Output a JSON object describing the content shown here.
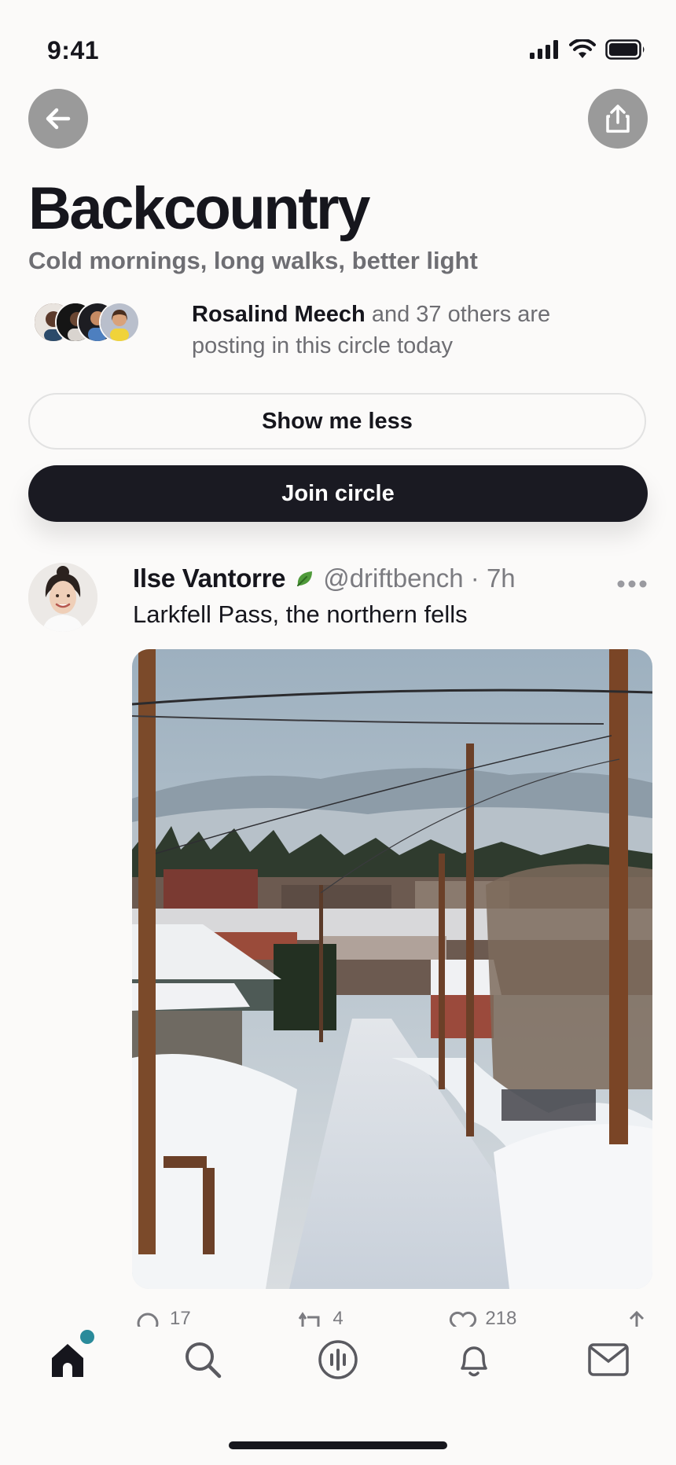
{
  "status_bar": {
    "time": "9:41"
  },
  "header": {
    "back_icon": "arrow-left-icon",
    "share_icon": "share-icon",
    "title": "Backcountry",
    "subtitle": "Cold mornings, long walks, better light"
  },
  "activity": {
    "name": "Rosalind Meech",
    "text": "and 37 others are posting in this circle today"
  },
  "buttons": {
    "show_less": "Show me less",
    "join": "Join circle"
  },
  "post": {
    "author": "Ilse Vantorre",
    "badge_icon": "leaf-icon",
    "handle": "@driftbench · 7h",
    "text": "Larkfell Pass, the northern fells",
    "image_desc_icon": "photo",
    "actions": {
      "replies": "17",
      "reposts": "4",
      "likes": "218"
    }
  },
  "tabbar": {
    "items": [
      "home-icon",
      "search-icon",
      "spaces-icon",
      "bell-icon",
      "mail-icon"
    ],
    "accent": "#2a8a9a"
  }
}
